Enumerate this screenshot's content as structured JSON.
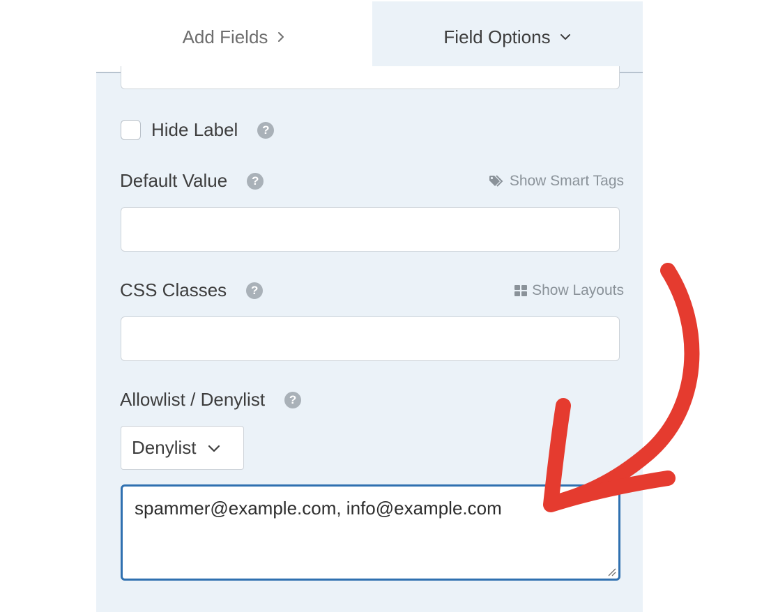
{
  "tabs": {
    "add_fields": "Add Fields",
    "field_options": "Field Options"
  },
  "field_options": {
    "hide_label": "Hide Label",
    "default_value": {
      "label": "Default Value",
      "link": "Show Smart Tags",
      "value": ""
    },
    "css_classes": {
      "label": "CSS Classes",
      "link": "Show Layouts",
      "value": ""
    },
    "allowlist": {
      "label": "Allowlist / Denylist",
      "selected": "Denylist",
      "entries": "spammer@example.com, info@example.com"
    }
  },
  "icons": {
    "tab_add": "chevron-right-icon",
    "tab_options": "chevron-down-icon",
    "help": "question-circle-icon",
    "smart_tags": "tags-icon",
    "layouts": "grid-icon",
    "select": "chevron-down-icon",
    "annotation": "red-curved-arrow"
  },
  "colors": {
    "panel_bg": "#ebf2f8",
    "focus_border": "#2f70b0",
    "annotation_arrow": "#e53b2f"
  }
}
